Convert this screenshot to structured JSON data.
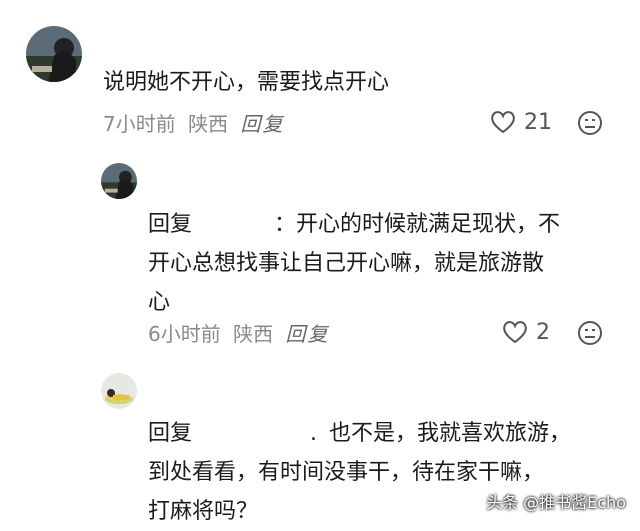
{
  "comments": [
    {
      "text": "说明她不开心，需要找点开心",
      "time": "7小时前",
      "location": "陕西",
      "reply_label": "回复",
      "likes": "21"
    },
    {
      "reply_prefix": "回复",
      "reply_sep": "：",
      "lines": [
        "开心的时候就满足现状，不",
        "开心总想找事让自己开心嘛，就是旅游散",
        "心"
      ],
      "time": "6小时前",
      "location": "陕西",
      "reply_label": "回复",
      "likes": "2"
    },
    {
      "reply_prefix": "回复",
      "reply_sep": ".",
      "lines": [
        "也不是，我就喜欢旅游，",
        "到处看看，有时间没事干，待在家干嘛，",
        "打麻将吗？"
      ]
    }
  ],
  "watermark": "头条 @推书酱Echo",
  "colors": {
    "meta": "#8a8a8a",
    "text": "#1b1b1b"
  }
}
